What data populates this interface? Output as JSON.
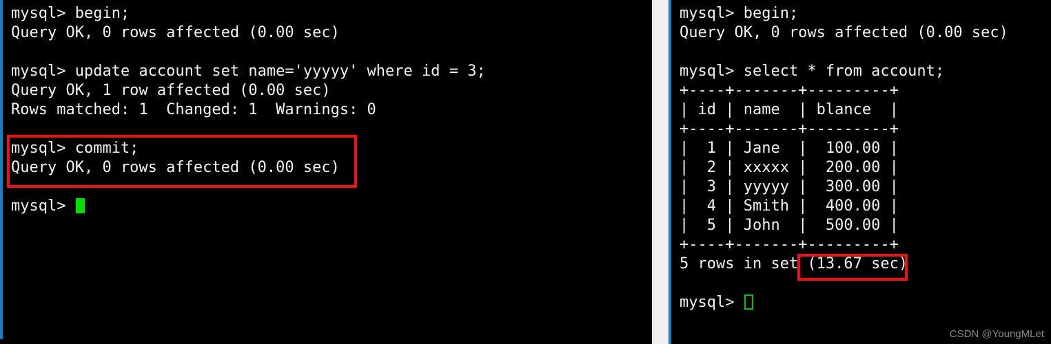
{
  "watermark": "CSDN @YoungMLet",
  "accent_colors": {
    "terminal_background": "#000000",
    "terminal_text": "#f2f2f2",
    "pane_border": "#1a7fc1",
    "gutter": "#efefef",
    "annotation_box": "#ee1111",
    "cursor_green": "#00e000"
  },
  "left_pane": {
    "name": "mysql-client-session-1",
    "lines": [
      "mysql> begin;",
      "Query OK, 0 rows affected (0.00 sec)",
      "",
      "mysql> update account set name='yyyyy' where id = 3;",
      "Query OK, 1 row affected (0.00 sec)",
      "Rows matched: 1  Changed: 1  Warnings: 0",
      "",
      "mysql> commit;",
      "Query OK, 0 rows affected (0.00 sec)",
      "",
      "mysql> "
    ],
    "prompt": "mysql> ",
    "cursor_style": "filled-block"
  },
  "right_pane": {
    "name": "mysql-client-session-2",
    "lines": [
      "mysql> begin;",
      "Query OK, 0 rows affected (0.00 sec)",
      "",
      "mysql> select * from account;",
      "+----+-------+---------+",
      "| id | name  | blance  |",
      "+----+-------+---------+",
      "|  1 | Jane  |  100.00 |",
      "|  2 | xxxxx |  200.00 |",
      "|  3 | yyyyy |  300.00 |",
      "|  4 | Smith |  400.00 |",
      "|  5 | John  |  500.00 |",
      "+----+-------+---------+",
      "5 rows in set (13.67 sec)",
      "",
      "mysql> "
    ],
    "prompt": "mysql> ",
    "cursor_style": "hollow-block",
    "result_table": {
      "columns": [
        "id",
        "name",
        "blance"
      ],
      "rows": [
        [
          "1",
          "Jane",
          "100.00"
        ],
        [
          "2",
          "xxxxx",
          "200.00"
        ],
        [
          "3",
          "yyyyy",
          "300.00"
        ],
        [
          "4",
          "Smith",
          "400.00"
        ],
        [
          "5",
          "John",
          "500.00"
        ]
      ],
      "footer": "5 rows in set (13.67 sec)",
      "row_count": "5",
      "duration": "13.67 sec"
    }
  },
  "annotations": [
    {
      "id": "annot-commit",
      "label": "commit-highlight"
    },
    {
      "id": "annot-duration",
      "label": "query-duration-highlight"
    }
  ]
}
